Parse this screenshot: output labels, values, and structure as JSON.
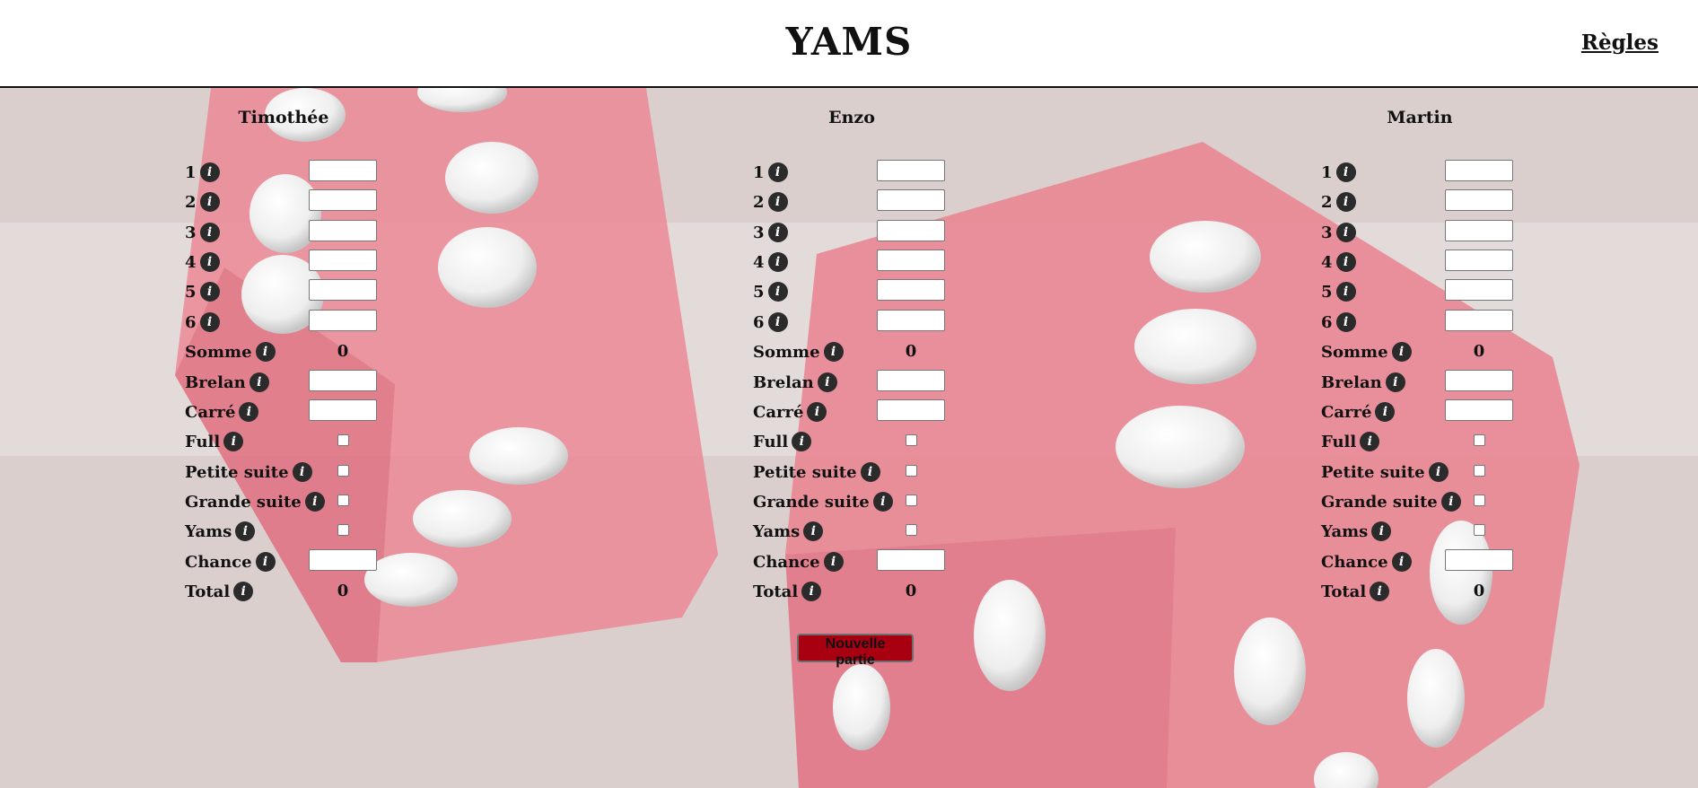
{
  "header": {
    "title": "YAMS",
    "rules_link": "Règles"
  },
  "info_icon_glyph": "i",
  "categories": [
    {
      "label": "1",
      "control": "input"
    },
    {
      "label": "2",
      "control": "input"
    },
    {
      "label": "3",
      "control": "input"
    },
    {
      "label": "4",
      "control": "input"
    },
    {
      "label": "5",
      "control": "input"
    },
    {
      "label": "6",
      "control": "input"
    },
    {
      "label": "Somme",
      "control": "value"
    },
    {
      "label": "Brelan",
      "control": "input"
    },
    {
      "label": "Carré",
      "control": "input"
    },
    {
      "label": "Full",
      "control": "checkbox"
    },
    {
      "label": "Petite suite",
      "control": "checkbox"
    },
    {
      "label": "Grande suite",
      "control": "checkbox"
    },
    {
      "label": "Yams",
      "control": "checkbox"
    },
    {
      "label": "Chance",
      "control": "input"
    },
    {
      "label": "Total",
      "control": "value"
    }
  ],
  "players": [
    {
      "name": "Timothée",
      "somme": "0",
      "total": "0"
    },
    {
      "name": "Enzo",
      "somme": "0",
      "total": "0"
    },
    {
      "name": "Martin",
      "somme": "0",
      "total": "0"
    }
  ],
  "new_game_button": "Nouvelle partie",
  "colors": {
    "accent": "#a80011",
    "dice": "#d9304a",
    "pip": "#f2f2f2",
    "info_icon_bg": "#2b2b2b"
  }
}
